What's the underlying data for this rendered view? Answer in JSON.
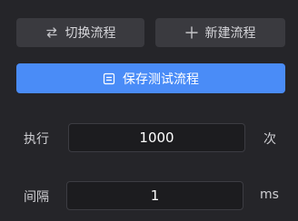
{
  "toolbar": {
    "switch_label": "切换流程",
    "switch_icon": "swap-icon",
    "new_label": "新建流程",
    "new_icon": "plus-icon",
    "save_label": "保存测试流程",
    "save_icon": "save-icon"
  },
  "execute": {
    "label": "执行",
    "value": "1000",
    "unit": "次"
  },
  "interval": {
    "label": "间隔",
    "value": "1",
    "unit": "ms"
  },
  "colors": {
    "background": "#252529",
    "button_gray": "#3a3a3f",
    "accent": "#4a8cf7",
    "field_background": "#1c1c1f"
  }
}
